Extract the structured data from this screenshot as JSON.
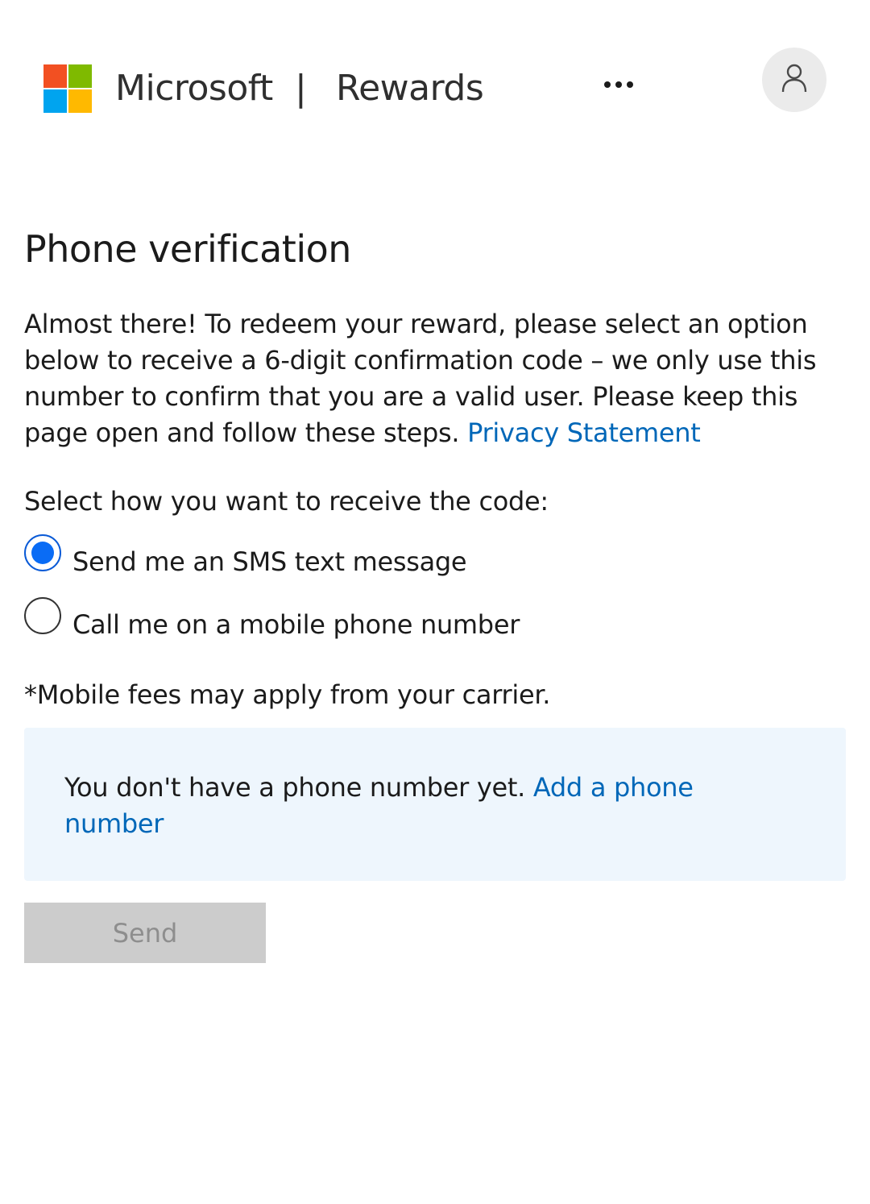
{
  "header": {
    "brand": "Microsoft",
    "divider": "|",
    "product": "Rewards",
    "more_icon": "more-dots-icon",
    "avatar_icon": "person-icon",
    "logo_colors": [
      "#f25022",
      "#7fba00",
      "#00a4ef",
      "#ffb900"
    ]
  },
  "main": {
    "title": "Phone verification",
    "intro": "Almost there! To redeem your reward, please select an option below to receive a 6-digit confirmation code – we only use this number to confirm that you are a valid user. Please keep this page open and follow these steps.",
    "privacy_link": "Privacy Statement",
    "prompt": "Select how you want to receive the code:",
    "options": [
      {
        "label": "Send me an SMS text message",
        "selected": true
      },
      {
        "label": "Call me on a mobile phone number",
        "selected": false
      }
    ],
    "fees_note": "*Mobile fees may apply from your carrier.",
    "notice": {
      "text": "You don't have a phone number yet.",
      "link": "Add a phone number"
    },
    "send_label": "Send",
    "send_disabled": true
  },
  "colors": {
    "link": "#0067b8",
    "radio_selected": "#0a6cf5",
    "notice_bg": "#eef6fd",
    "button_disabled_bg": "#cccccc"
  }
}
